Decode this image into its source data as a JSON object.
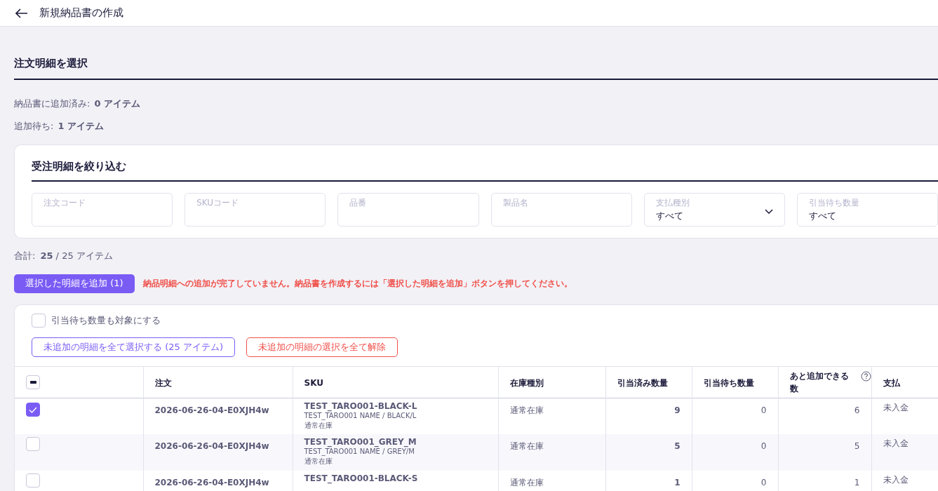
{
  "header": {
    "title": "新規納品書の作成"
  },
  "section": {
    "title": "注文明細を選択"
  },
  "summary": [
    {
      "label": "納品書に追加済み:",
      "value": "0 アイテム"
    },
    {
      "label": "追加待ち:",
      "value": "1 アイテム"
    }
  ],
  "filter": {
    "title": "受注明細を絞り込む",
    "fields": [
      {
        "kind": "text",
        "label": "注文コード"
      },
      {
        "kind": "text",
        "label": "SKUコード"
      },
      {
        "kind": "text",
        "label": "品番"
      },
      {
        "kind": "text",
        "label": "製品名"
      },
      {
        "kind": "select",
        "label": "支払種別",
        "value": "すべて"
      },
      {
        "kind": "select",
        "label": "引当待ち数量",
        "value": "すべて"
      }
    ]
  },
  "total": {
    "label": "合計:",
    "count": "25",
    "rest": "/ 25 アイテム"
  },
  "add_button": "選択した明細を追加 (1)",
  "warning": "納品明細への追加が完了していません。納品書を作成するには「選択した明細を追加」ボタンを押してください。",
  "include_pending": {
    "label": "引当待ち数量も対象にする",
    "checked": false
  },
  "select_all_button": "未追加の明細を全て選択する (25 アイテム)",
  "clear_button": "未追加の明細の選択を全て解除",
  "table": {
    "header_indeterminate": true,
    "columns": [
      "注文",
      "SKU",
      "在庫種別",
      "引当済み数量",
      "引当待ち数量",
      "あと追加できる数",
      "支払"
    ],
    "rows": [
      {
        "selected": true,
        "order": "2026-06-26-04-E0XJH4w",
        "sku": "TEST_TARO001-BLACK-L",
        "sku_name": "TEST_TARO001 NAME / BLACK/L",
        "sku_stock": "通常在庫",
        "stock_type": "通常在庫",
        "allocated": "9",
        "pending": "0",
        "remaining": "6",
        "payment": "未入金"
      },
      {
        "selected": false,
        "order": "2026-06-26-04-E0XJH4w",
        "sku": "TEST_TARO001_GREY_M",
        "sku_name": "TEST_TARO001 NAME / GREY/M",
        "sku_stock": "通常在庫",
        "stock_type": "通常在庫",
        "allocated": "5",
        "pending": "0",
        "remaining": "5",
        "payment": "未入金"
      },
      {
        "selected": false,
        "order": "2026-06-26-04-E0XJH4w",
        "sku": "TEST_TARO001-BLACK-S",
        "stock_type": "通常在庫",
        "allocated": "1",
        "pending": "0",
        "remaining": "1",
        "payment": "未入金"
      }
    ]
  }
}
